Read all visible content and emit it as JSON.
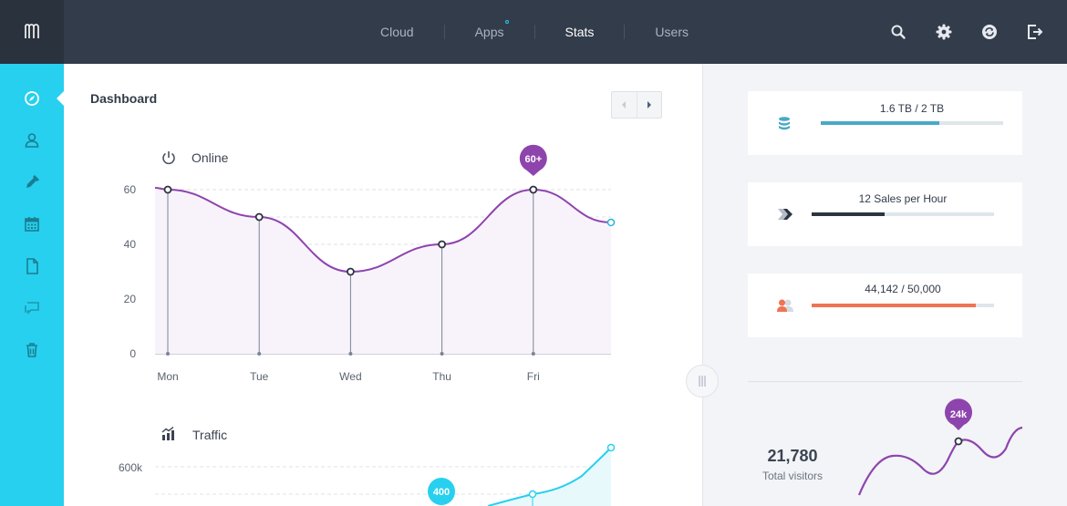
{
  "topbar": {
    "nav": [
      {
        "label": "Cloud",
        "active": false
      },
      {
        "label": "Apps",
        "active": false,
        "badge": true
      },
      {
        "label": "Stats",
        "active": true
      },
      {
        "label": "Users",
        "active": false
      }
    ],
    "icons": [
      "search-icon",
      "settings-icon",
      "sync-icon",
      "logout-icon"
    ],
    "logo": "app-logo"
  },
  "sidebar": {
    "items": [
      {
        "icon": "compass-icon",
        "active": true
      },
      {
        "icon": "user-icon",
        "active": false
      },
      {
        "icon": "pen-icon",
        "active": false
      },
      {
        "icon": "calendar-icon",
        "active": false
      },
      {
        "icon": "file-icon",
        "active": false
      },
      {
        "icon": "chat-icon",
        "active": false
      },
      {
        "icon": "trash-icon",
        "active": false
      }
    ]
  },
  "dashboard": {
    "title": "Dashboard"
  },
  "charts": {
    "online": {
      "title": "Online",
      "icon": "power-icon",
      "marker_label": "60+"
    },
    "traffic": {
      "title": "Traffic",
      "icon": "bar-chart-icon",
      "marker_label": "400",
      "ytick_label": "600k"
    }
  },
  "chart_data": [
    {
      "type": "area",
      "title": "Online",
      "categories": [
        "Mon",
        "Tue",
        "Wed",
        "Thu",
        "Fri"
      ],
      "values": [
        60,
        50,
        30,
        40,
        60
      ],
      "ylim": [
        0,
        60
      ],
      "yticks": [
        0,
        20,
        40,
        60
      ],
      "annotation": "60+",
      "color": "#8e44ad"
    },
    {
      "type": "area",
      "title": "Traffic",
      "yticks": [
        "600k"
      ],
      "annotation": "400",
      "color": "#27d0ee"
    }
  ],
  "stats": [
    {
      "label": "1.6 TB / 2 TB",
      "icon": "database-icon",
      "fill": 0.65,
      "color": "#4aa8c7"
    },
    {
      "label": "12 Sales per Hour",
      "icon": "tags-icon",
      "fill": 0.4,
      "color": "#2c3440"
    },
    {
      "label": "44,142 / 50,000",
      "icon": "users-icon",
      "fill": 0.9,
      "color": "#f07354"
    }
  ],
  "visitors": {
    "value": "21,780",
    "label": "Total visitors",
    "marker_label": "24k",
    "color": "#8e44ad"
  }
}
